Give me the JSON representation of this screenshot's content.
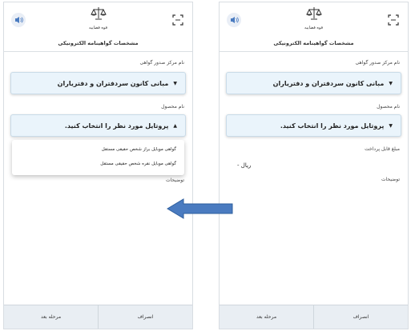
{
  "left_screen": {
    "header": {
      "emblem_caption": "قوه قضاییه",
      "left_icon": "speaker-icon",
      "right_icon": "scan-icon"
    },
    "title": "مشخصات گواهینامه الکترونیکی",
    "issuer_label": "نام مرکز صدور گواهی",
    "issuer_value": "مبانی کانون سردفتران و دفتریاران",
    "product_label": "نام محصول",
    "product_placeholder": "پروتایل مورد نظر را انتخاب کنید.",
    "options": [
      "گواهی موبایل براز شخص حقیقی مستقل",
      "گواهی موبایل نقره شخص حقیقی مستقل"
    ],
    "description_label": "توضیحات",
    "footer": {
      "cancel": "انصراف",
      "next": "مرحله بعد"
    }
  },
  "right_screen": {
    "header": {
      "emblem_caption": "قوه قضاییه",
      "left_icon": "speaker-icon",
      "right_icon": "scan-icon"
    },
    "title": "مشخصات گواهینامه الکترونیکی",
    "issuer_label": "نام مرکز صدور گواهی",
    "issuer_value": "مبانی کانون سردفتران و دفتریاران",
    "product_label": "نام محصول",
    "product_placeholder": "پروتایل مورد نظر را انتخاب کنید.",
    "payable_label": "مبلغ قابل پرداخت",
    "payable_value": "- ریال",
    "description_label": "توضیحات",
    "footer": {
      "cancel": "انصراف",
      "next": "مرحله بعد"
    }
  },
  "arrow": {
    "direction": "left",
    "color": "#4a7bc0"
  },
  "colors": {
    "select_bg": "#eaf4fb",
    "footer_bg": "#e9eef3"
  }
}
